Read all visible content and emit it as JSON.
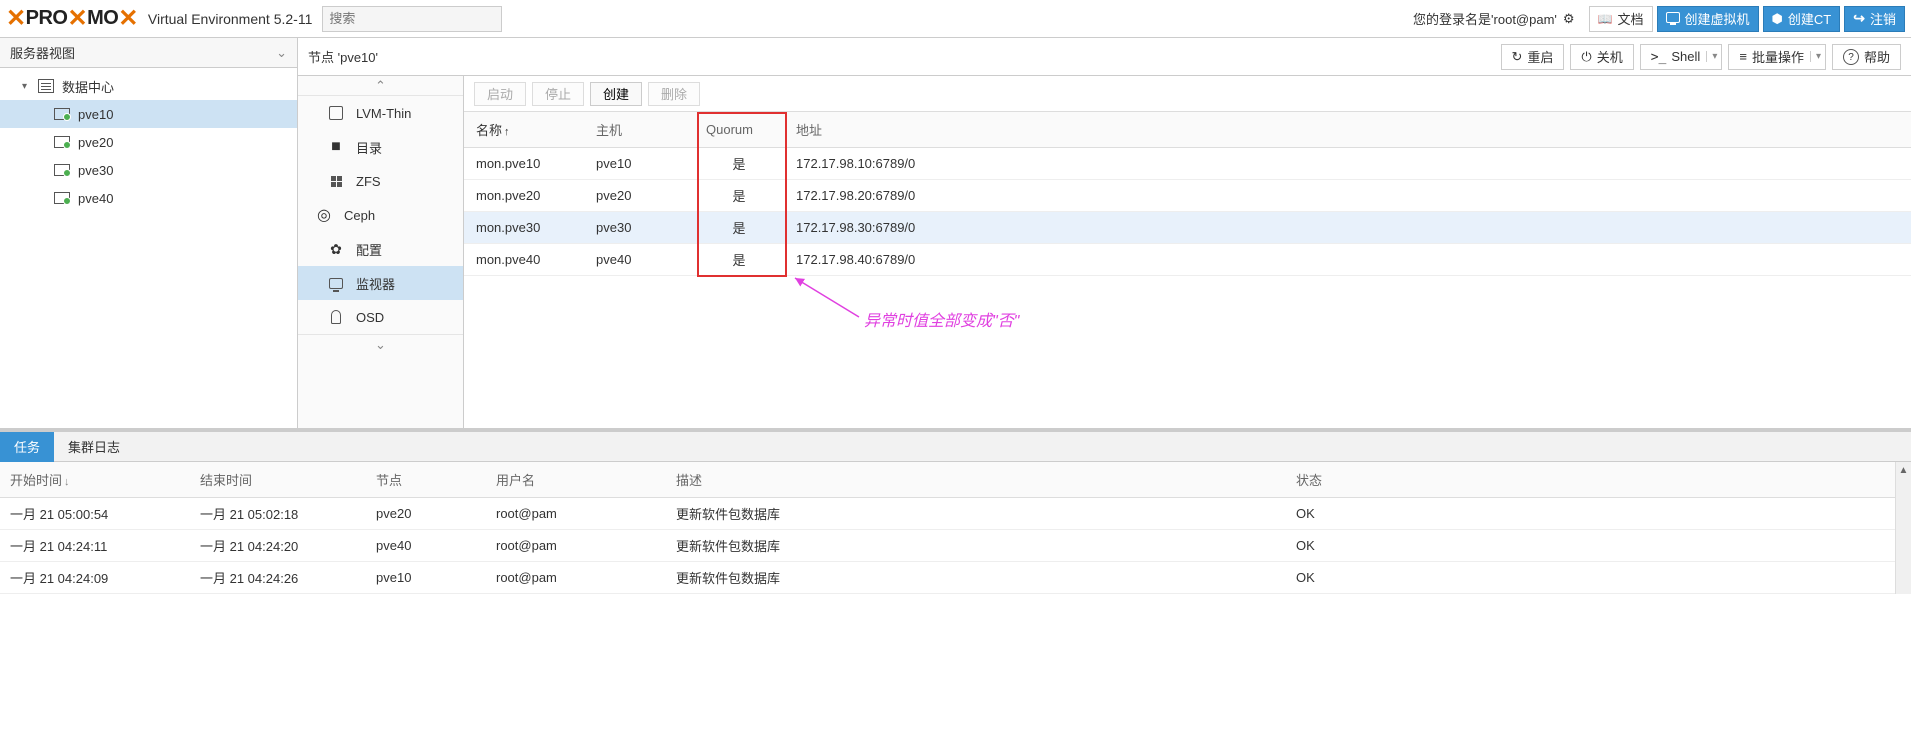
{
  "header": {
    "logo_pro": "PRO",
    "logo_mo": "MO",
    "ve_label": "Virtual Environment 5.2-11",
    "search_placeholder": "搜索",
    "login_info": "您的登录名是'root@pam'",
    "docs": "文档",
    "create_vm": "创建虚拟机",
    "create_ct": "创建CT",
    "logout": "注销"
  },
  "tree": {
    "view_name": "服务器视图",
    "datacenter": "数据中心",
    "nodes": [
      "pve10",
      "pve20",
      "pve30",
      "pve40"
    ]
  },
  "node": {
    "title": "节点 'pve10'",
    "reboot": "重启",
    "shutdown": "关机",
    "shell": "Shell",
    "bulk": "批量操作",
    "help": "帮助"
  },
  "nav": {
    "lvm_thin": "LVM-Thin",
    "directory": "目录",
    "zfs": "ZFS",
    "ceph": "Ceph",
    "config": "配置",
    "monitor": "监视器",
    "osd": "OSD"
  },
  "mon_panel": {
    "start": "启动",
    "stop": "停止",
    "create": "创建",
    "delete": "删除",
    "col_name": "名称",
    "col_host": "主机",
    "col_quorum": "Quorum",
    "col_addr": "地址",
    "rows": [
      {
        "name": "mon.pve10",
        "host": "pve10",
        "quorum": "是",
        "addr": "172.17.98.10:6789/0"
      },
      {
        "name": "mon.pve20",
        "host": "pve20",
        "quorum": "是",
        "addr": "172.17.98.20:6789/0"
      },
      {
        "name": "mon.pve30",
        "host": "pve30",
        "quorum": "是",
        "addr": "172.17.98.30:6789/0"
      },
      {
        "name": "mon.pve40",
        "host": "pve40",
        "quorum": "是",
        "addr": "172.17.98.40:6789/0"
      }
    ],
    "annotation": "异常时值全部变成\"否\""
  },
  "log": {
    "tab_tasks": "任务",
    "tab_cluster": "集群日志",
    "col_start": "开始时间",
    "col_end": "结束时间",
    "col_node": "节点",
    "col_user": "用户名",
    "col_desc": "描述",
    "col_status": "状态",
    "rows": [
      {
        "start": "一月 21 05:00:54",
        "end": "一月 21 05:02:18",
        "node": "pve20",
        "user": "root@pam",
        "desc": "更新软件包数据库",
        "status": "OK"
      },
      {
        "start": "一月 21 04:24:11",
        "end": "一月 21 04:24:20",
        "node": "pve40",
        "user": "root@pam",
        "desc": "更新软件包数据库",
        "status": "OK"
      },
      {
        "start": "一月 21 04:24:09",
        "end": "一月 21 04:24:26",
        "node": "pve10",
        "user": "root@pam",
        "desc": "更新软件包数据库",
        "status": "OK"
      }
    ]
  }
}
